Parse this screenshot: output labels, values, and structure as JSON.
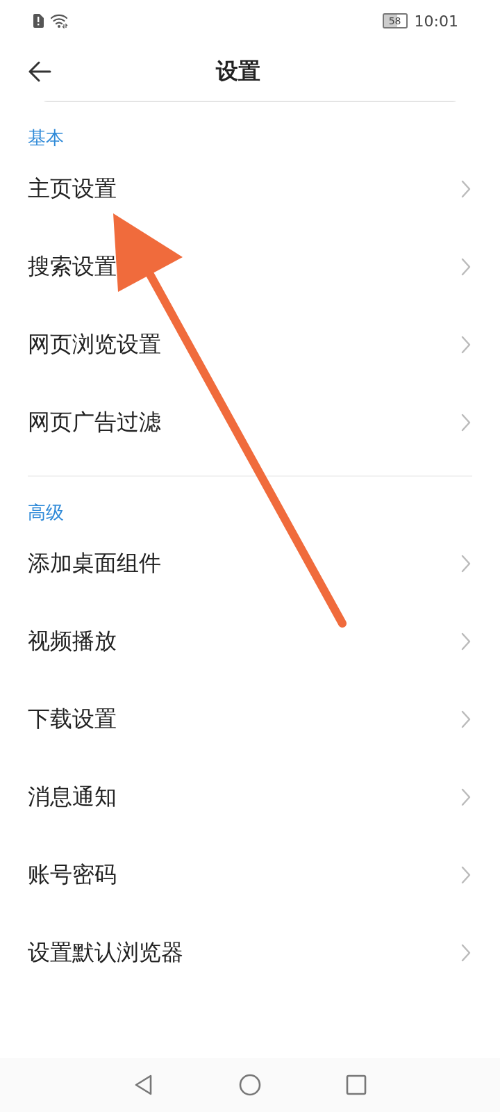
{
  "status_bar": {
    "battery": "58",
    "time": "10:01"
  },
  "header": {
    "title": "设置"
  },
  "sections": [
    {
      "title": "基本",
      "items": [
        {
          "label": "主页设置"
        },
        {
          "label": "搜索设置"
        },
        {
          "label": "网页浏览设置"
        },
        {
          "label": "网页广告过滤"
        }
      ]
    },
    {
      "title": "高级",
      "items": [
        {
          "label": "添加桌面组件"
        },
        {
          "label": "视频播放"
        },
        {
          "label": "下载设置"
        },
        {
          "label": "消息通知"
        },
        {
          "label": "账号密码"
        },
        {
          "label": "设置默认浏览器"
        }
      ]
    }
  ]
}
